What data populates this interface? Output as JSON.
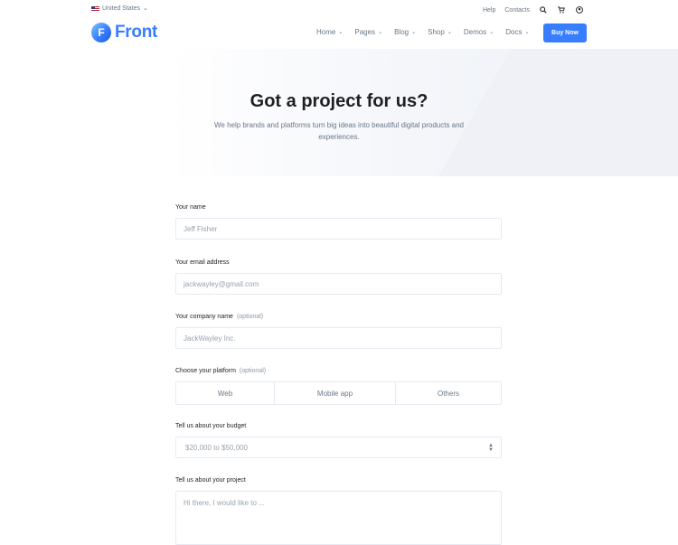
{
  "topbar": {
    "country": "United States",
    "links": [
      "Help",
      "Contacts"
    ],
    "icons": [
      "search-icon",
      "cart-icon",
      "user-icon"
    ]
  },
  "nav": {
    "logo_letter": "F",
    "logo_text": "Front",
    "menu": [
      "Home",
      "Pages",
      "Blog",
      "Shop",
      "Demos",
      "Docs"
    ],
    "buy_label": "Buy Now"
  },
  "hero": {
    "title": "Got a project for us?",
    "subtitle": "We help brands and platforms turn big ideas into beautiful digital products and experiences."
  },
  "form": {
    "name_label": "Your name",
    "name_placeholder": "Jeff Fisher",
    "email_label": "Your email address",
    "email_placeholder": "jackwayley@gmail.com",
    "company_label": "Your company name",
    "company_optional": "(optional)",
    "company_placeholder": "JackWayley Inc.",
    "platform_label": "Choose your platform",
    "platform_optional": "(optional)",
    "platforms": [
      "Web",
      "Mobile app",
      "Others"
    ],
    "budget_label": "Tell us about your budget",
    "budget_value": "$20,000 to $50,000",
    "project_label": "Tell us about your project",
    "project_placeholder": "Hi there, I would like to ..."
  },
  "colors": {
    "accent": "#377dff",
    "text": "#1e2022",
    "muted": "#677788",
    "border": "#e7eaf3"
  }
}
